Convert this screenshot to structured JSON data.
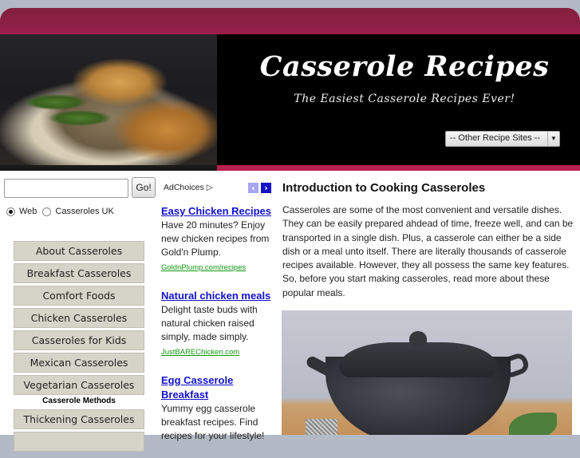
{
  "header": {
    "title": "Casserole Recipes",
    "subtitle": "The Easiest Casserole Recipes Ever!",
    "hero_image_alt": "green bean casserole image",
    "site_select": {
      "selected": "-- Other Recipe Sites --"
    }
  },
  "search": {
    "input_value": "",
    "go_label": "Go!",
    "radios": [
      {
        "label": "Web",
        "checked": true
      },
      {
        "label": "Casseroles UK",
        "checked": false
      }
    ]
  },
  "nav": {
    "items": [
      "About Casseroles",
      "Breakfast Casseroles",
      "Comfort Foods",
      "Chicken Casseroles",
      "Casseroles for Kids",
      "Mexican Casseroles",
      "Vegetarian Casseroles"
    ],
    "section_heading": "Casserole Methods",
    "section_items": [
      "Thickening Casseroles"
    ]
  },
  "ads": {
    "adchoices_label": "AdChoices",
    "prev_icon": "‹",
    "next_icon": "›",
    "items": [
      {
        "title": "Easy Chicken Recipes",
        "desc": "Have 20 minutes? Enjoy new chicken recipes from Gold'n Plump.",
        "url": "GoldnPlump.com/recipes"
      },
      {
        "title": "Natural chicken meals",
        "desc": "Delight taste buds with natural chicken raised simply, made simply.",
        "url": "JustBAREChicken.com"
      },
      {
        "title": "Egg Casserole Breakfast",
        "desc": "Yummy egg casserole breakfast recipes. Find recipes for your lifestyle!",
        "url": ""
      }
    ]
  },
  "main": {
    "title": "Introduction to Cooking Casseroles",
    "paragraph": "Casseroles are some of the most convenient and versatile dishes. They can be easily prepared ahdead of time, freeze well, and can be transported in a single dish. Plus, a casserole can either be a side dish or a meal unto itself. There are literally thousands of casserole recipes available. However, they all possess the same key features. So, before you start making casseroles, read more about these popular meals.",
    "image_alt": "black casserole pot image"
  },
  "colors": {
    "brand_maroon": "#8d1f45",
    "accent_pink": "#b8204f",
    "link_blue": "#1111cc",
    "url_green": "#119911"
  }
}
